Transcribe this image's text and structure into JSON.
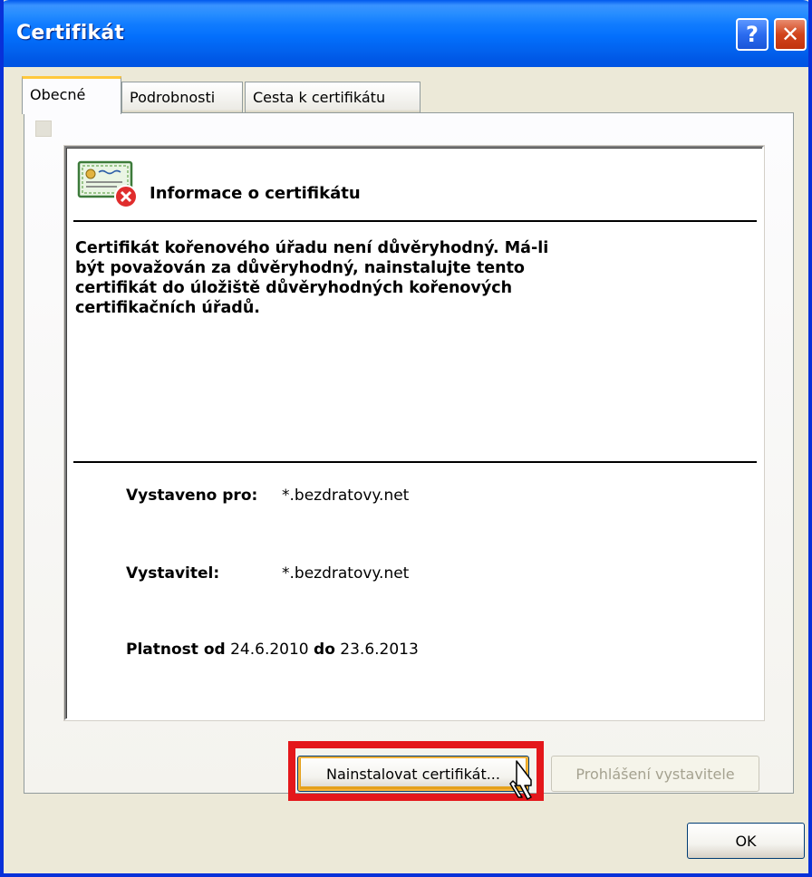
{
  "window": {
    "title": "Certifikát"
  },
  "titlebar": {
    "help_label": "?",
    "close_label": "✕"
  },
  "tabs": [
    {
      "label": "Obecné",
      "active": true
    },
    {
      "label": "Podrobnosti",
      "active": false
    },
    {
      "label": "Cesta k certifikátu",
      "active": false
    }
  ],
  "info": {
    "icon": "certificate-error-icon",
    "title": "Informace o certifikátu",
    "body_lines": [
      "Certifikát kořenového úřadu není důvěryhodný. Má-li",
      "být považován za důvěryhodný, nainstalujte tento",
      "certifikát do úložiště důvěryhodných kořenových",
      "certifikačních úřadů."
    ]
  },
  "fields": {
    "issued_to_label": "Vystaveno pro:",
    "issued_to_value": "*.bezdratovy.net",
    "issuer_label": "Vystavitel:",
    "issuer_value": "*.bezdratovy.net",
    "valid_from_label": "Platnost od",
    "valid_from_value": "24.6.2010",
    "valid_to_label": "do",
    "valid_to_value": "23.6.2013"
  },
  "buttons": {
    "install": "Nainstalovat certifikát...",
    "issuer_statement": "Prohlášení vystavitele",
    "ok": "OK"
  },
  "colors": {
    "xp_blue": "#0054E3",
    "highlight_red": "#E4171B",
    "dialog_bg": "#ECE9D8"
  }
}
